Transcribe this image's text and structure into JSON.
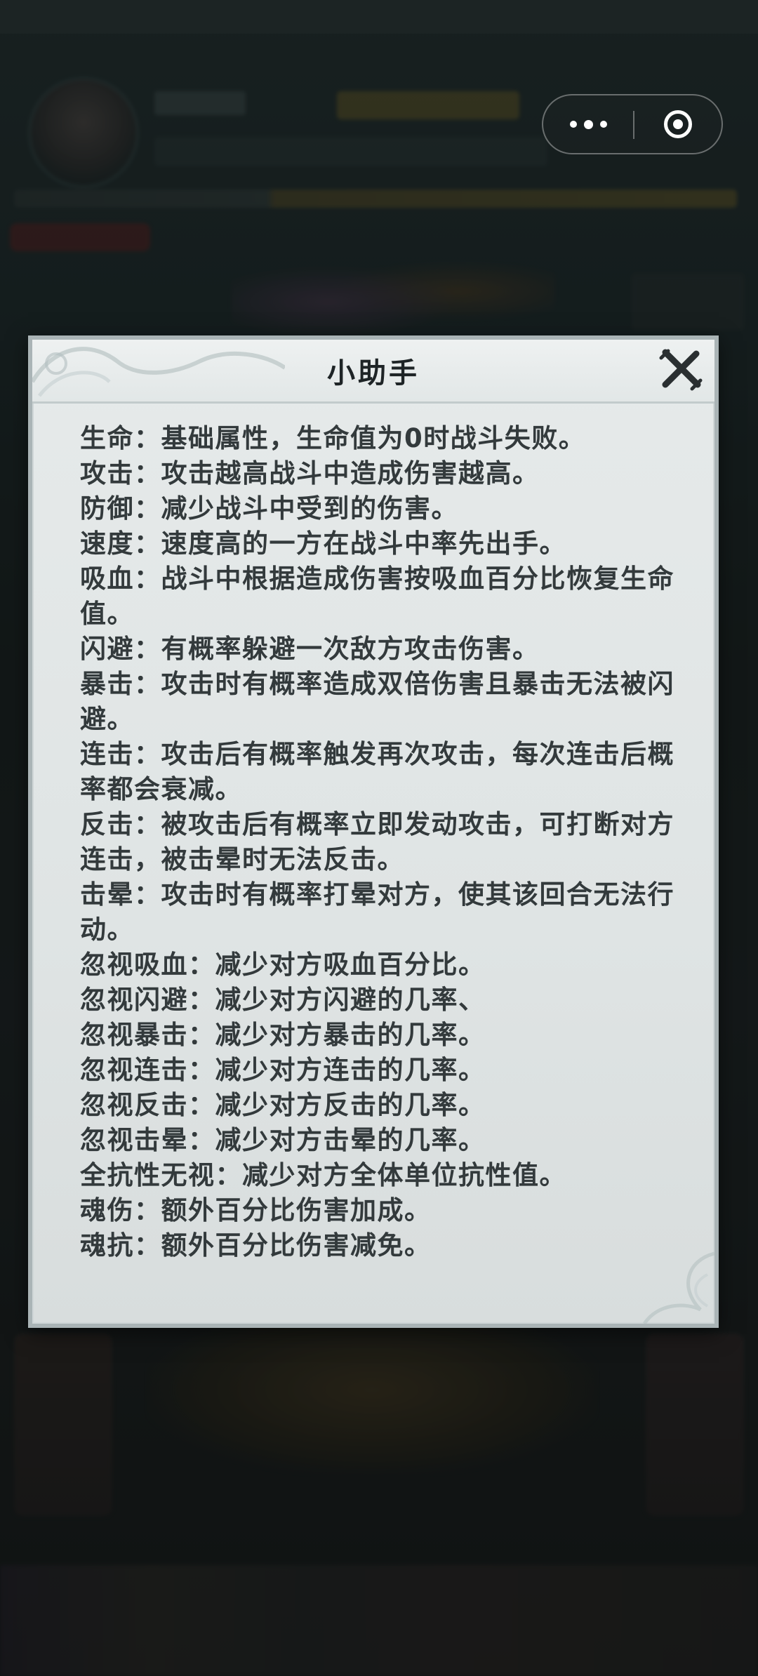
{
  "dialog": {
    "title": "小助手",
    "lines": [
      "生命：基础属性，生命值为0时战斗失败。",
      "攻击：攻击越高战斗中造成伤害越高。",
      "防御：减少战斗中受到的伤害。",
      "速度：速度高的一方在战斗中率先出手。",
      "吸血：战斗中根据造成伤害按吸血百分比恢复生命值。",
      "闪避：有概率躲避一次敌方攻击伤害。",
      "暴击：攻击时有概率造成双倍伤害且暴击无法被闪避。",
      "连击：攻击后有概率触发再次攻击，每次连击后概率都会衰减。",
      "反击：被攻击后有概率立即发动攻击，可打断对方连击，被击晕时无法反击。",
      "击晕：攻击时有概率打晕对方，使其该回合无法行动。",
      "忽视吸血：减少对方吸血百分比。",
      "忽视闪避：减少对方闪避的几率、",
      "忽视暴击：减少对方暴击的几率。",
      "忽视连击：减少对方连击的几率。",
      "忽视反击：减少对方反击的几率。",
      "忽视击晕：减少对方击晕的几率。",
      "全抗性无视：减少对方全体单位抗性值。",
      "魂伤：额外百分比伤害加成。",
      "魂抗：额外百分比伤害减免。"
    ]
  },
  "capsule": {
    "more_icon": "more-dots-icon",
    "close_icon": "target-close-icon"
  },
  "colors": {
    "dialog_bg": "#e2e7e7",
    "dialog_border": "#aab4b6",
    "text": "#333a3c",
    "title": "#1e2426"
  }
}
